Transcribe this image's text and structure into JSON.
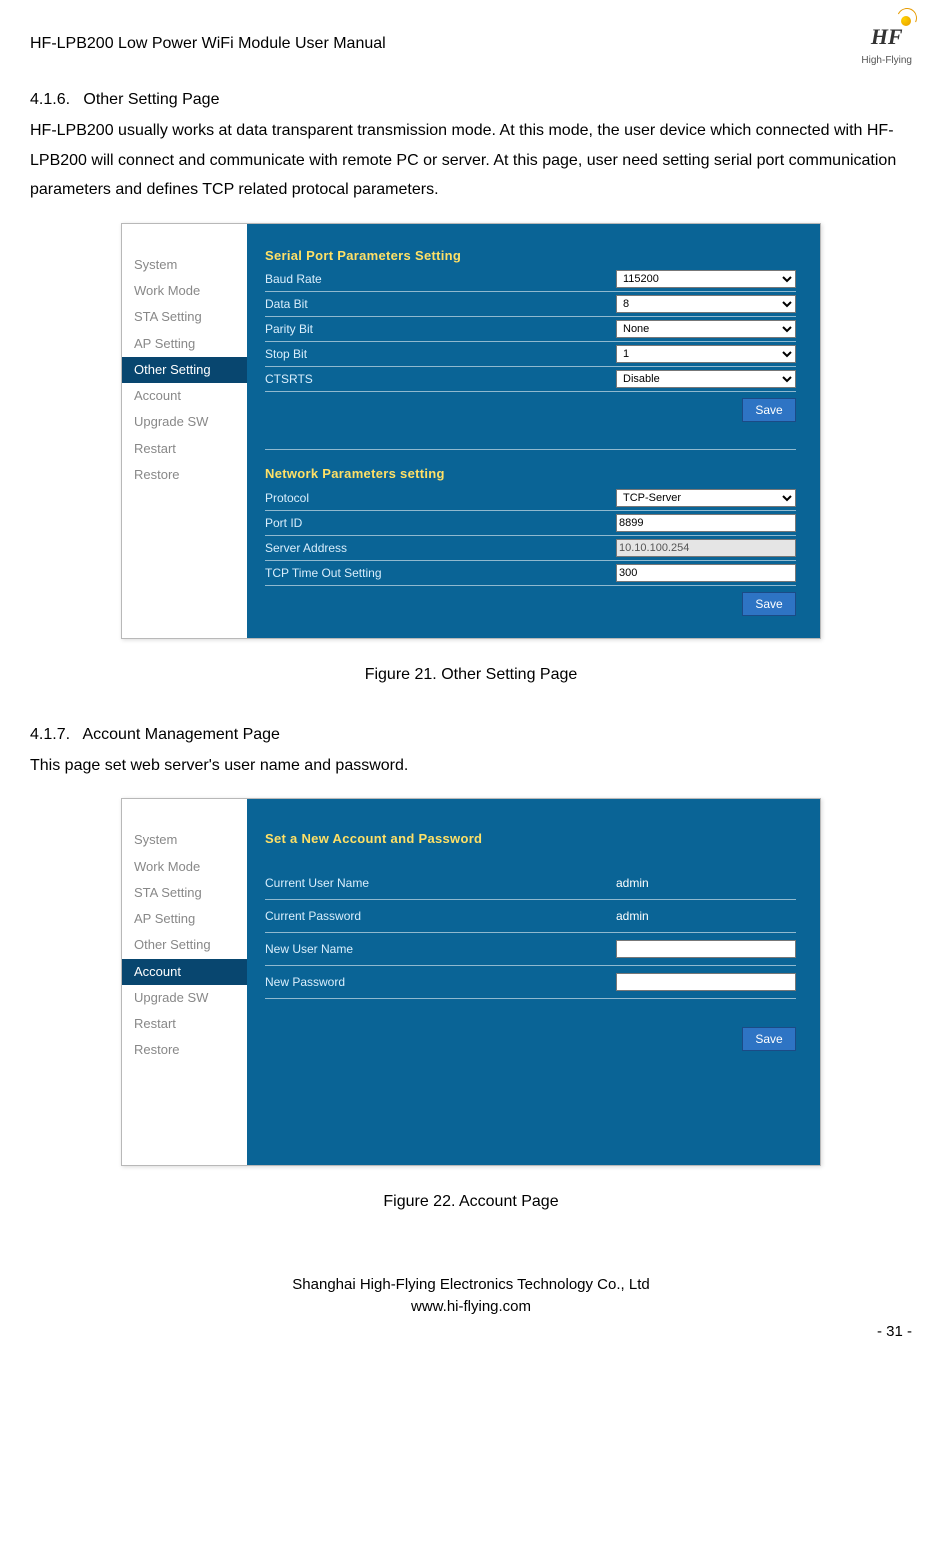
{
  "header": {
    "title": "HF-LPB200 Low Power WiFi Module User Manual",
    "logo_text": "HF",
    "logo_sub": "High-Flying"
  },
  "section1": {
    "number": "4.1.6.",
    "title": "Other Setting Page",
    "body": "HF-LPB200 usually works at data transparent transmission mode. At this mode, the user device which connected with HF-LPB200 will connect and communicate with remote PC or server. At this page, user need setting serial port communication parameters and defines TCP related protocal parameters."
  },
  "figure21": {
    "caption": "Figure 21.   Other Setting Page",
    "sidebar": [
      {
        "label": "System",
        "active": false
      },
      {
        "label": "Work Mode",
        "active": false
      },
      {
        "label": "STA Setting",
        "active": false
      },
      {
        "label": "AP Setting",
        "active": false
      },
      {
        "label": "Other Setting",
        "active": true
      },
      {
        "label": "Account",
        "active": false
      },
      {
        "label": "Upgrade SW",
        "active": false
      },
      {
        "label": "Restart",
        "active": false
      },
      {
        "label": "Restore",
        "active": false
      }
    ],
    "panel1_title": "Serial Port Parameters Setting",
    "panel1_rows": [
      {
        "label": "Baud Rate",
        "value": "115200",
        "type": "select"
      },
      {
        "label": "Data Bit",
        "value": "8",
        "type": "select"
      },
      {
        "label": "Parity Bit",
        "value": "None",
        "type": "select"
      },
      {
        "label": "Stop Bit",
        "value": "1",
        "type": "select"
      },
      {
        "label": "CTSRTS",
        "value": "Disable",
        "type": "select"
      }
    ],
    "panel2_title": "Network Parameters setting",
    "panel2_rows": [
      {
        "label": "Protocol",
        "value": "TCP-Server",
        "type": "select"
      },
      {
        "label": "Port ID",
        "value": "8899",
        "type": "text"
      },
      {
        "label": "Server Address",
        "value": "10.10.100.254",
        "type": "text_ro"
      },
      {
        "label": "TCP Time Out Setting",
        "value": "300",
        "type": "text"
      }
    ],
    "save_label": "Save"
  },
  "section2": {
    "number": "4.1.7.",
    "title": "Account Management Page",
    "body": "This page set web server's user name and password."
  },
  "figure22": {
    "caption": "Figure 22.   Account Page",
    "sidebar": [
      {
        "label": "System",
        "active": false
      },
      {
        "label": "Work Mode",
        "active": false
      },
      {
        "label": "STA Setting",
        "active": false
      },
      {
        "label": "AP Setting",
        "active": false
      },
      {
        "label": "Other Setting",
        "active": false
      },
      {
        "label": "Account",
        "active": true
      },
      {
        "label": "Upgrade SW",
        "active": false
      },
      {
        "label": "Restart",
        "active": false
      },
      {
        "label": "Restore",
        "active": false
      }
    ],
    "panel_title": "Set a New Account and Password",
    "rows": [
      {
        "label": "Current User Name",
        "value": "admin",
        "type": "static"
      },
      {
        "label": "Current Password",
        "value": "admin",
        "type": "static"
      },
      {
        "label": "New User Name",
        "value": "",
        "type": "text"
      },
      {
        "label": "New Password",
        "value": "",
        "type": "text"
      }
    ],
    "save_label": "Save"
  },
  "footer": {
    "company": "Shanghai High-Flying Electronics Technology Co., Ltd",
    "url": "www.hi-flying.com",
    "page": "- 31 -"
  }
}
